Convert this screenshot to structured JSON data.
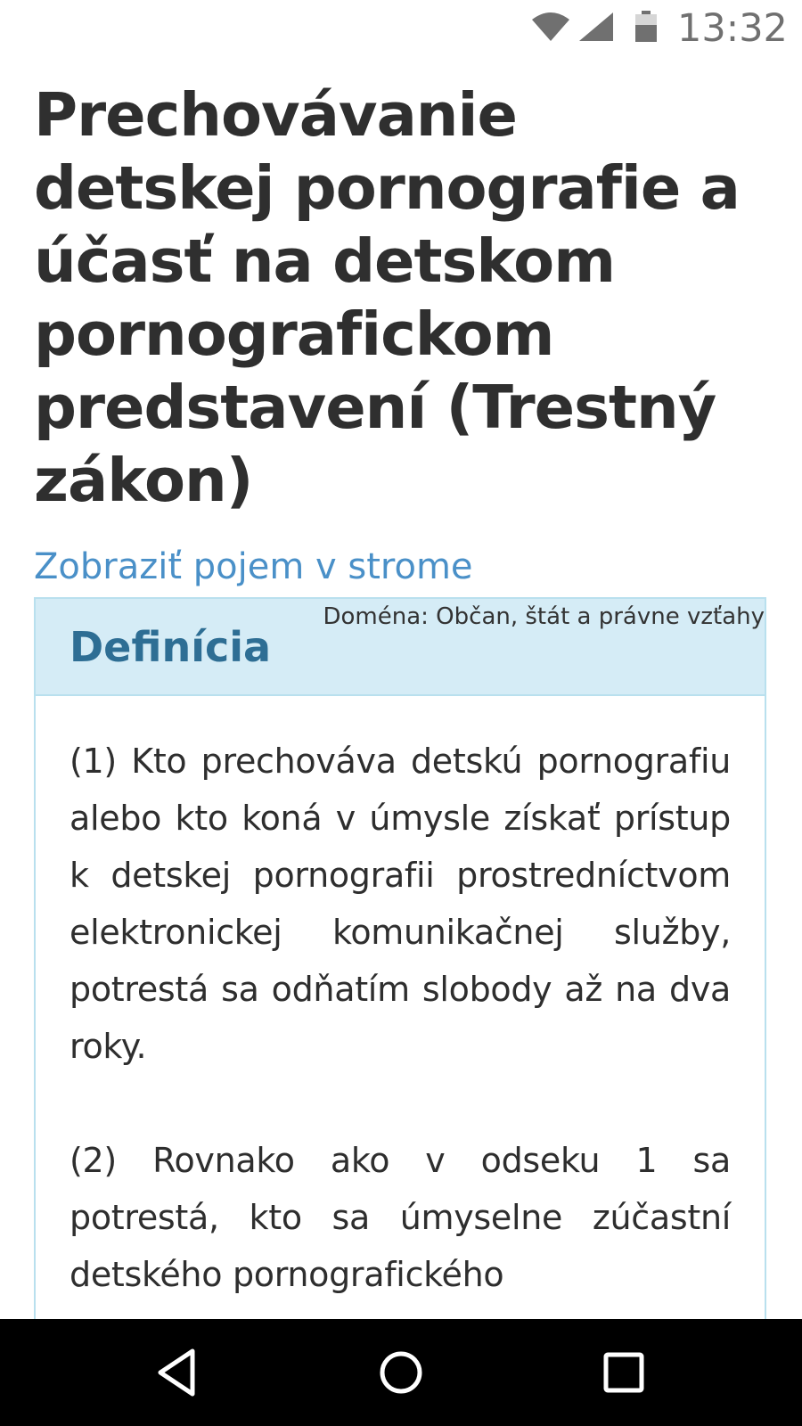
{
  "status_bar": {
    "time": "13:32",
    "icons": [
      "wifi-icon",
      "cell-signal-icon",
      "battery-icon"
    ]
  },
  "page": {
    "title": "Prechovávanie detskej pornografie a účasť na detskom pornografickom predstavení (Trestný zákon)",
    "tree_link": "Zobraziť pojem v strome"
  },
  "definition": {
    "domain": "Doména: Občan, štát a právne vzťahy",
    "title": "Definícia",
    "paragraphs": [
      "(1) Kto prechováva detskú pornografiu alebo kto koná v úmysle získať prístup k detskej pornografii prostredníctvom elektronickej komunikačnej služby, potrestá sa odňatím slobody až na dva roky.",
      "(2) Rovnako ako v odseku 1 sa potrestá, kto sa úmyselne zúčastní detského pornografického"
    ]
  },
  "nav_bar": {
    "icons": [
      "back-icon",
      "home-icon",
      "recent-apps-icon"
    ]
  },
  "colors": {
    "link": "#4a90c8",
    "panel_header_bg": "#d5ecf6",
    "panel_border": "#b9e0ee",
    "panel_title": "#2e6e94",
    "text": "#2e2e2e"
  }
}
